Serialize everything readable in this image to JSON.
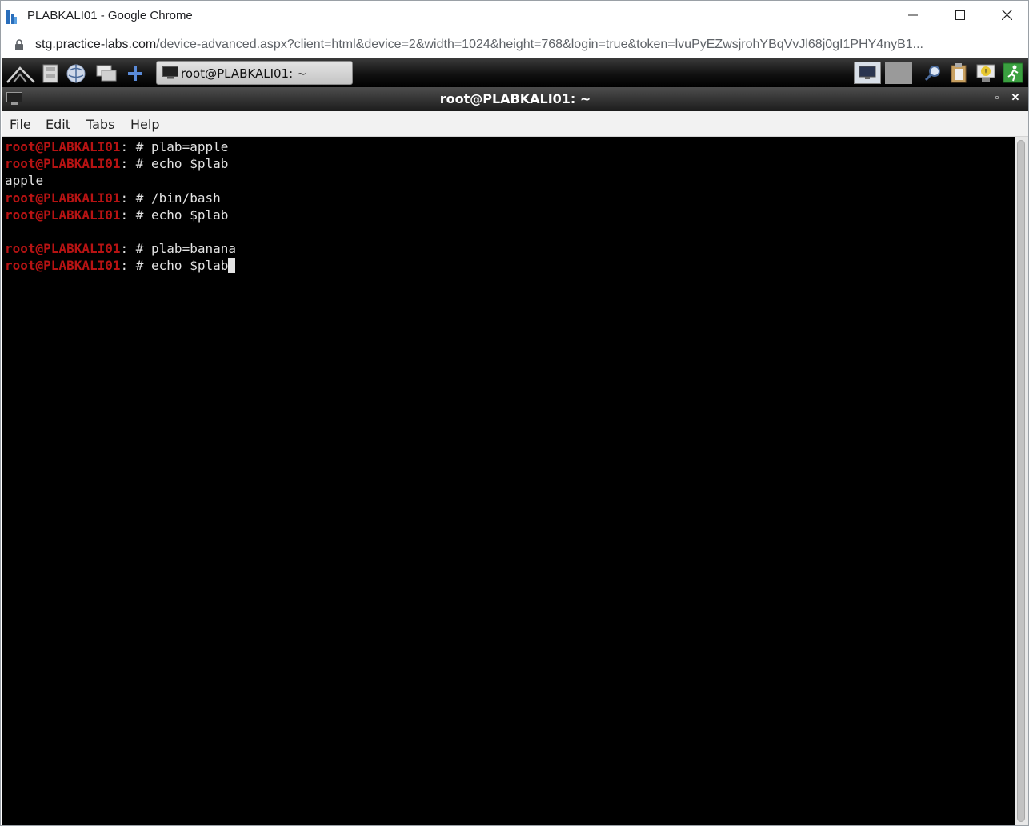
{
  "browser": {
    "window_title": "PLABKALI01 - Google Chrome",
    "url_host": "stg.practice-labs.com",
    "url_rest": "/device-advanced.aspx?client=html&device=2&width=1024&height=768&login=true&token=lvuPyEZwsjrohYBqVvJl68j0gI1PHY4nyB1...",
    "icons": [
      "practice-labs-logo-icon",
      "minimize-icon",
      "maximize-icon",
      "close-icon",
      "lock-icon"
    ]
  },
  "taskbar": {
    "launcher_icons": [
      "kali-menu-icon",
      "file-manager-icon",
      "browser-icon",
      "show-desktop-icon",
      "add-icon"
    ],
    "task_button_label": "root@PLABKALI01: ~",
    "tray_icons": [
      "workspace-1-icon",
      "workspace-2-icon",
      "search-icon",
      "clipboard-icon",
      "notification-icon",
      "logout-icon"
    ]
  },
  "terminal": {
    "title": "root@PLABKALI01: ~",
    "controls": {
      "minimize": "_",
      "maximize": "▫",
      "close": "✕"
    },
    "menu": [
      "File",
      "Edit",
      "Tabs",
      "Help"
    ],
    "prompt_user": "root@PLABKALI01",
    "prompt_suffix": ": # ",
    "lines": [
      {
        "type": "prompt",
        "cmd": "plab=apple"
      },
      {
        "type": "prompt",
        "cmd": "echo $plab"
      },
      {
        "type": "output",
        "text": "apple"
      },
      {
        "type": "prompt",
        "cmd": "/bin/bash"
      },
      {
        "type": "prompt",
        "cmd": "echo $plab"
      },
      {
        "type": "output",
        "text": ""
      },
      {
        "type": "prompt",
        "cmd": "plab=banana"
      },
      {
        "type": "prompt",
        "cmd": "echo $plab",
        "cursor": true
      }
    ]
  },
  "colors": {
    "prompt_red": "#b71313",
    "terminal_bg": "#000000",
    "terminal_fg": "#e3e3e3"
  }
}
